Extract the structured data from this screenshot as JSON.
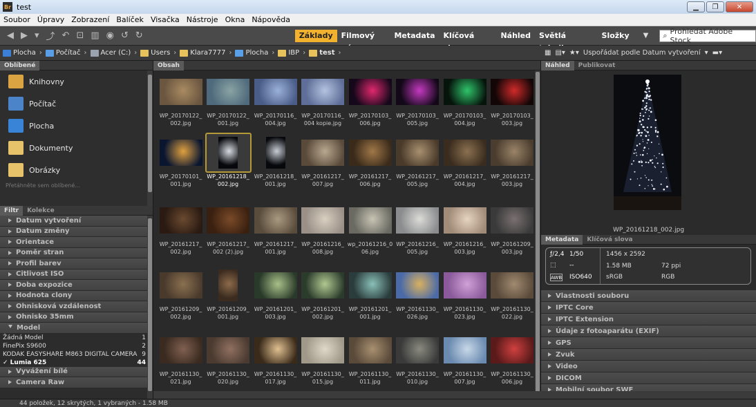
{
  "window": {
    "title": "test",
    "app_icon": "Br"
  },
  "menu": [
    "Soubor",
    "Úpravy",
    "Zobrazení",
    "Balíček",
    "Visačka",
    "Nástroje",
    "Okna",
    "Nápověda"
  ],
  "workspaces": {
    "tabs": [
      "Základy",
      "Filmový pás",
      "Metadata",
      "Klíčová slova",
      "Náhled",
      "Světlá tabulka",
      "Složky"
    ],
    "active": "Základy"
  },
  "stock_search": {
    "placeholder": "Prohledat Adobe Stock"
  },
  "breadcrumb": [
    {
      "label": "Plocha",
      "icon": "desktop-icon",
      "color": "#3b7fd6"
    },
    {
      "label": "Počítač",
      "icon": "computer-icon",
      "color": "#5b9ee8"
    },
    {
      "label": "Acer (C:)",
      "icon": "drive-icon",
      "color": "#9aa3ad"
    },
    {
      "label": "Users",
      "icon": "folder-icon",
      "color": "#e8c25a"
    },
    {
      "label": "Klara7777",
      "icon": "folder-icon",
      "color": "#e8c25a"
    },
    {
      "label": "Plocha",
      "icon": "desktop-folder-icon",
      "color": "#5aa0e8"
    },
    {
      "label": "IBP",
      "icon": "folder-icon",
      "color": "#e8c25a"
    },
    {
      "label": "test",
      "icon": "folder-icon",
      "color": "#e8c25a",
      "bold": true
    }
  ],
  "sort": {
    "label": "Uspořádat podle Datum vytvoření"
  },
  "left": {
    "tabs": [
      "Oblíbené"
    ],
    "favorites": [
      {
        "label": "Knihovny",
        "color": "#d9a441"
      },
      {
        "label": "Počítač",
        "color": "#4b84c8"
      },
      {
        "label": "Plocha",
        "color": "#3a84d8"
      },
      {
        "label": "Dokumenty",
        "color": "#e6c36a"
      },
      {
        "label": "Obrázky",
        "color": "#e6c36a"
      }
    ],
    "hint": "Přetáhněte sem oblíbené..."
  },
  "filter": {
    "tabs": [
      "Filtr",
      "Kolekce"
    ],
    "rows": [
      "Datum vytvoření",
      "Datum změny",
      "Orientace",
      "Poměr stran",
      "Profil barev",
      "Citlivost ISO",
      "Doba expozice",
      "Hodnota clony",
      "Ohnisková vzdálenost",
      "Ohnisko 35mm"
    ],
    "model": {
      "title": "Model",
      "items": [
        {
          "name": "Žádná Model",
          "count": "1"
        },
        {
          "name": "FinePix S9600",
          "count": "2"
        },
        {
          "name": "KODAK EASYSHARE M863 DIGITAL CAMERA",
          "count": "9"
        },
        {
          "name": "✓ Lumia 625",
          "count": "44",
          "selected": true
        }
      ]
    },
    "rows_after": [
      "Vyvážení bílé",
      "Camera Raw"
    ]
  },
  "content": {
    "tab": "Obsah",
    "items": [
      {
        "name": "WP_20170122_\n002.jpg",
        "colors": [
          "#6b5640",
          "#a98b62"
        ],
        "orient": "landscape"
      },
      {
        "name": "WP_20170122_\n001.jpg",
        "colors": [
          "#4f6a7c",
          "#8aa3a4"
        ],
        "orient": "landscape"
      },
      {
        "name": "WP_20170116_\n004.jpg",
        "colors": [
          "#4a5c88",
          "#9bb1d8"
        ],
        "orient": "landscape"
      },
      {
        "name": "WP_20170116_\n004 kopie.jpg",
        "colors": [
          "#5e6e98",
          "#b4c3e0"
        ],
        "orient": "landscape"
      },
      {
        "name": "WP_20170103_\n006.jpg",
        "colors": [
          "#14081a",
          "#e0286e"
        ],
        "orient": "landscape"
      },
      {
        "name": "WP_20170103_\n005.jpg",
        "colors": [
          "#120818",
          "#c43ac0"
        ],
        "orient": "landscape"
      },
      {
        "name": "WP_20170103_\n004.jpg",
        "colors": [
          "#06140c",
          "#2fc46a"
        ],
        "orient": "landscape"
      },
      {
        "name": "WP_20170103_\n003.jpg",
        "colors": [
          "#120606",
          "#d02a2a"
        ],
        "orient": "landscape"
      },
      {
        "name": "WP_20170101_\n001.jpg",
        "colors": [
          "#0a1630",
          "#e0a040"
        ],
        "orient": "landscape"
      },
      {
        "name": "WP_20161218_\n002.jpg",
        "colors": [
          "#06080c",
          "#d8dce2"
        ],
        "orient": "portrait",
        "selected": true
      },
      {
        "name": "WP_20161218_\n001.jpg",
        "colors": [
          "#06080c",
          "#c8ccd4"
        ],
        "orient": "portrait"
      },
      {
        "name": "WP_20161217_\n007.jpg",
        "colors": [
          "#5a4a3a",
          "#b8a890"
        ],
        "orient": "landscape"
      },
      {
        "name": "WP_20161217_\n006.jpg",
        "colors": [
          "#3a2a1a",
          "#a07848"
        ],
        "orient": "landscape"
      },
      {
        "name": "WP_20161217_\n005.jpg",
        "colors": [
          "#4a3a2a",
          "#a89070"
        ],
        "orient": "landscape"
      },
      {
        "name": "WP_20161217_\n004.jpg",
        "colors": [
          "#3a2c1e",
          "#8a7050"
        ],
        "orient": "landscape"
      },
      {
        "name": "WP_20161217_\n003.jpg",
        "colors": [
          "#4a3c2e",
          "#9a8468"
        ],
        "orient": "landscape"
      },
      {
        "name": "WP_20161217_\n002.jpg",
        "colors": [
          "#2a1a12",
          "#6a4a30"
        ],
        "orient": "landscape"
      },
      {
        "name": "WP_20161217_\n002 (2).jpg",
        "colors": [
          "#3a2010",
          "#7a4a28"
        ],
        "orient": "landscape"
      },
      {
        "name": "WP_20161217_\n001.jpg",
        "colors": [
          "#5a4c3c",
          "#a89a80"
        ],
        "orient": "landscape"
      },
      {
        "name": "WP_20161216_\n008.jpg",
        "colors": [
          "#9a9088",
          "#d8d0c0"
        ],
        "orient": "landscape"
      },
      {
        "name": "wp_20161216_0\n06.jpg",
        "colors": [
          "#6a6a62",
          "#c8c4b4"
        ],
        "orient": "landscape"
      },
      {
        "name": "WP_20161216_\n005.jpg",
        "colors": [
          "#8a8c8e",
          "#dcdcd8"
        ],
        "orient": "landscape"
      },
      {
        "name": "WP_20161216_\n003.jpg",
        "colors": [
          "#a08a78",
          "#e6d4c0"
        ],
        "orient": "landscape"
      },
      {
        "name": "WP_20161209_\n003.jpg",
        "colors": [
          "#3a3a3a",
          "#7a7070"
        ],
        "orient": "landscape"
      },
      {
        "name": "WP_20161209_\n002.jpg",
        "colors": [
          "#4a3a2c",
          "#8a7050"
        ],
        "orient": "landscape"
      },
      {
        "name": "WP_20161209_\n001.jpg",
        "colors": [
          "#3c2c20",
          "#8c6a4a"
        ],
        "orient": "portrait"
      },
      {
        "name": "WP_20161201_\n003.jpg",
        "colors": [
          "#2a3a2a",
          "#a8c088"
        ],
        "orient": "landscape"
      },
      {
        "name": "WP_20161201_\n002.jpg",
        "colors": [
          "#2c3c2c",
          "#b0c890"
        ],
        "orient": "landscape"
      },
      {
        "name": "WP_20161201_\n001.jpg",
        "colors": [
          "#2a3c3c",
          "#8ac0b8"
        ],
        "orient": "landscape"
      },
      {
        "name": "WP_20161130_\n026.jpg",
        "colors": [
          "#4a6aa8",
          "#d8b060"
        ],
        "orient": "landscape"
      },
      {
        "name": "WP_20161130_\n023.jpg",
        "colors": [
          "#8a5a9a",
          "#d0a0d8"
        ],
        "orient": "landscape"
      },
      {
        "name": "WP_20161130_\n022.jpg",
        "colors": [
          "#5a4a3a",
          "#a08a70"
        ],
        "orient": "landscape"
      },
      {
        "name": "WP_20161130_\n021.jpg",
        "colors": [
          "#3a2a20",
          "#806050"
        ],
        "orient": "landscape"
      },
      {
        "name": "WP_20161130_\n020.jpg",
        "colors": [
          "#4a3a30",
          "#907060"
        ],
        "orient": "landscape"
      },
      {
        "name": "WP_20161130_\n017.jpg",
        "colors": [
          "#3a2a1a",
          "#e0c090"
        ],
        "orient": "landscape"
      },
      {
        "name": "WP_20161130_\n015.jpg",
        "colors": [
          "#a09888",
          "#e0d8c8"
        ],
        "orient": "landscape"
      },
      {
        "name": "WP_20161130_\n011.jpg",
        "colors": [
          "#5a4a3a",
          "#a89070"
        ],
        "orient": "landscape"
      },
      {
        "name": "WP_20161130_\n010.jpg",
        "colors": [
          "#3a3a3a",
          "#8a8a80"
        ],
        "orient": "landscape"
      },
      {
        "name": "WP_20161130_\n007.jpg",
        "colors": [
          "#6a8ab0",
          "#c8d8e8"
        ],
        "orient": "landscape"
      },
      {
        "name": "WP_20161130_\n006.jpg",
        "colors": [
          "#5a1a1a",
          "#d04040"
        ],
        "orient": "landscape"
      }
    ]
  },
  "preview": {
    "tabs": [
      "Náhled",
      "Publikovat"
    ],
    "caption": "WP_20161218_002.jpg"
  },
  "metadata": {
    "tabs": [
      "Metadata",
      "Klíčová slova"
    ],
    "aperture": "ƒ/2,4",
    "shutter": "1/50",
    "focus": "--",
    "awb": "AWB",
    "iso": "ISO640",
    "dimensions": "1456 x 2592",
    "size": "1.58 MB",
    "ppi": "72 ppi",
    "profile": "sRGB",
    "mode": "RGB",
    "sections": [
      "Vlastnosti souboru",
      "IPTC Core",
      "IPTC Extension",
      "Údaje z fotoaparátu (EXIF)",
      "GPS",
      "Zvuk",
      "Video",
      "DICOM",
      "Mobilní soubor SWF"
    ]
  },
  "status": "44 položek, 12 skrytých, 1 vybraných - 1.58 MB"
}
